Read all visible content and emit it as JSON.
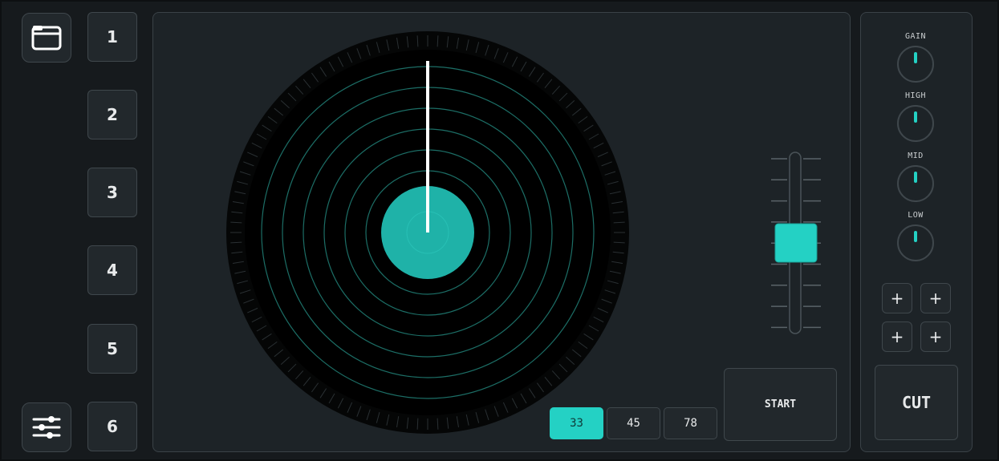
{
  "sidebar": {
    "folder_icon": "folder-icon",
    "settings_icon": "sliders-icon",
    "pads": [
      {
        "label": "1"
      },
      {
        "label": "2"
      },
      {
        "label": "3"
      },
      {
        "label": "4"
      },
      {
        "label": "5"
      },
      {
        "label": "6"
      }
    ]
  },
  "deck": {
    "speeds": [
      {
        "label": "33",
        "active": true
      },
      {
        "label": "45",
        "active": false
      },
      {
        "label": "78",
        "active": false
      }
    ],
    "start_label": "START"
  },
  "mixer": {
    "knobs": [
      {
        "label": "GAIN"
      },
      {
        "label": "HIGH"
      },
      {
        "label": "MID"
      },
      {
        "label": "LOW"
      }
    ],
    "plus_buttons": [
      "+",
      "+",
      "+",
      "+"
    ],
    "cut_label": "CUT"
  },
  "colors": {
    "accent": "#24d1c4",
    "background": "#161a1d",
    "panel": "#1d2327",
    "record": "#050606"
  }
}
